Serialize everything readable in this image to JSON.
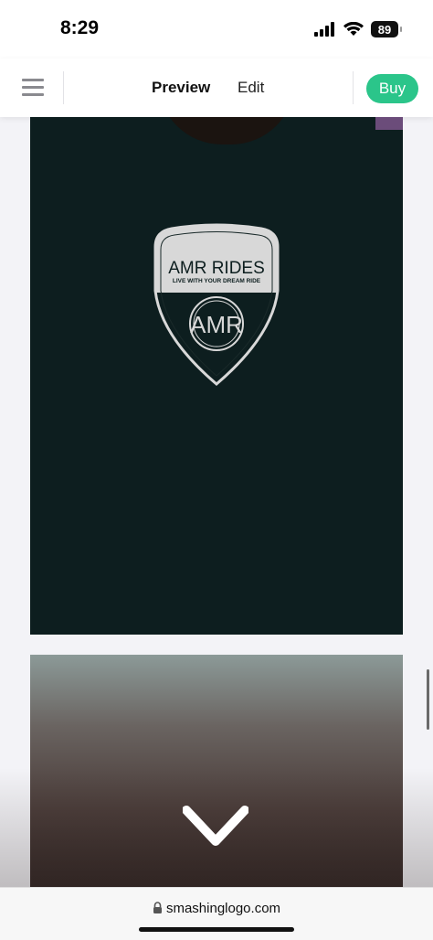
{
  "status_bar": {
    "time": "8:29",
    "battery": "89",
    "icons": [
      "signal-icon",
      "wifi-icon",
      "battery-icon"
    ]
  },
  "toolbar": {
    "menu_icon": "hamburger-menu-icon",
    "tabs": [
      {
        "label": "Preview",
        "active": true
      },
      {
        "label": "Edit",
        "active": false
      }
    ],
    "buy_label": "Buy",
    "accent": "#2bc58a"
  },
  "preview": {
    "logo": {
      "title": "AMR RIDES",
      "tagline": "LIVE WITH YOUR DREAM RIDE",
      "monogram": "AMR"
    },
    "scroll_icon": "chevron-down-icon"
  },
  "browser": {
    "url": "smashinglogo.com",
    "lock_icon": "lock-icon"
  }
}
